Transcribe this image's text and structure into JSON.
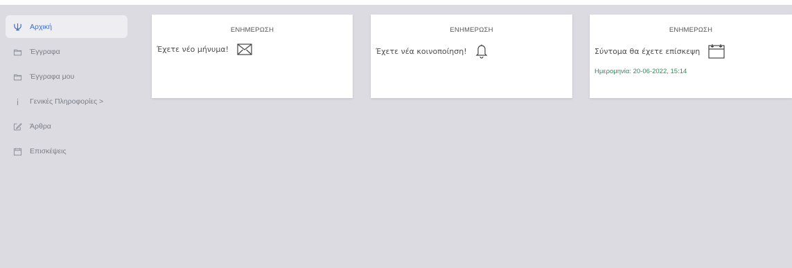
{
  "sidebar": {
    "items": [
      {
        "label": "Αρχική",
        "icon": "trident-icon",
        "active": true
      },
      {
        "label": "Έγγραφα",
        "icon": "folder-icon"
      },
      {
        "label": "Έγγραφα μου",
        "icon": "folder-icon"
      },
      {
        "label": "Γενικές Πληροφορίες >",
        "icon": "info-icon"
      },
      {
        "label": "Άρθρα",
        "icon": "edit-icon"
      },
      {
        "label": "Επισκέψεις",
        "icon": "calendar-icon"
      }
    ]
  },
  "cards": [
    {
      "header": "ΕΝΗΜΕΡΩΣΗ",
      "text": "Έχετε νέο μήνυμα!",
      "icon": "envelope-icon"
    },
    {
      "header": "ΕΝΗΜΕΡΩΣΗ",
      "text": "Έχετε νέα κοινοποίηση!",
      "icon": "bell-icon"
    },
    {
      "header": "ΕΝΗΜΕΡΩΣΗ",
      "text": "Σύντομα θα έχετε επίσκεψη",
      "icon": "calendar-icon",
      "subtext": "Ημερομηνία: 20-06-2022, 15:14"
    }
  ],
  "colors": {
    "accent": "#2f6fd6",
    "date_green": "#2e8b57",
    "background": "#dcdbe1"
  }
}
